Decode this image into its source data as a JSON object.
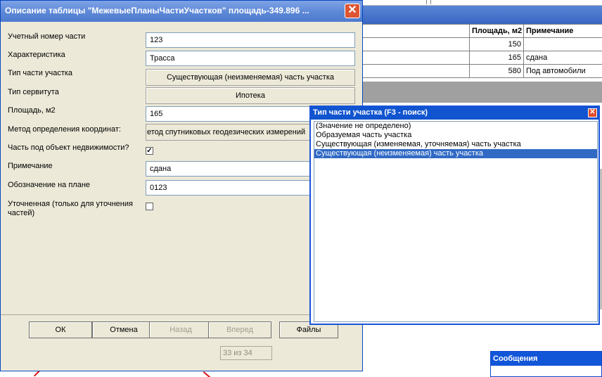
{
  "dialog": {
    "title": "Описание таблицы \"МежевыеПланыЧастиУчастков\"  площадь-349.896 ...",
    "close_symbol": "✕"
  },
  "fields": {
    "account_number": {
      "label": "Учетный номер части",
      "value": "123"
    },
    "characteristic": {
      "label": "Характеристика",
      "value": "Трасса"
    },
    "part_type": {
      "label": "Тип части участка",
      "value": "Существующая (неизменяемая) часть участка"
    },
    "servitude_type": {
      "label": "Тип сервитута",
      "value": "Ипотека"
    },
    "area": {
      "label": "Площадь, м2",
      "value": "165"
    },
    "coord_method": {
      "label": "Метод определения координат:",
      "value": "етод спутниковых геодезических измерений"
    },
    "real_estate_part": {
      "label": "Часть под объект недвижимости?",
      "checked": "✓"
    },
    "note": {
      "label": "Примечание",
      "value": "сдана"
    },
    "plan_designation": {
      "label": "Обозначение на плане",
      "value": "0123"
    },
    "refined": {
      "label": "Уточненная (только для уточнения частей)",
      "checked": ""
    }
  },
  "buttons": {
    "ok": "ОК",
    "cancel": "Отмена",
    "back": "Назад",
    "forward": "Вперед",
    "files": "Файлы"
  },
  "counter": "33 из 34",
  "popup": {
    "title": "Тип части участка (F3 - поиск)",
    "close_symbol": "✕",
    "items": [
      "(Значение не определено)",
      "Образуемая часть участка",
      "Существующая (изменяемая, уточняемая) часть участка",
      "Существующая (неизменяемая) часть участка"
    ],
    "selected_index": 3
  },
  "background_table": {
    "headers": [
      "Площадь, м2",
      "Примечание"
    ],
    "rows": [
      {
        "area": "150",
        "note": ""
      },
      {
        "area": "165",
        "note": "сдана"
      },
      {
        "area": "580",
        "note": "Под автомобили"
      }
    ]
  },
  "messages_window": {
    "title": "Сообщения"
  },
  "colors": {
    "title_bar": "#5d88d6",
    "selection": "#316ac5",
    "dialog_bg": "#ece9d8",
    "popup_title": "#1154cf"
  }
}
